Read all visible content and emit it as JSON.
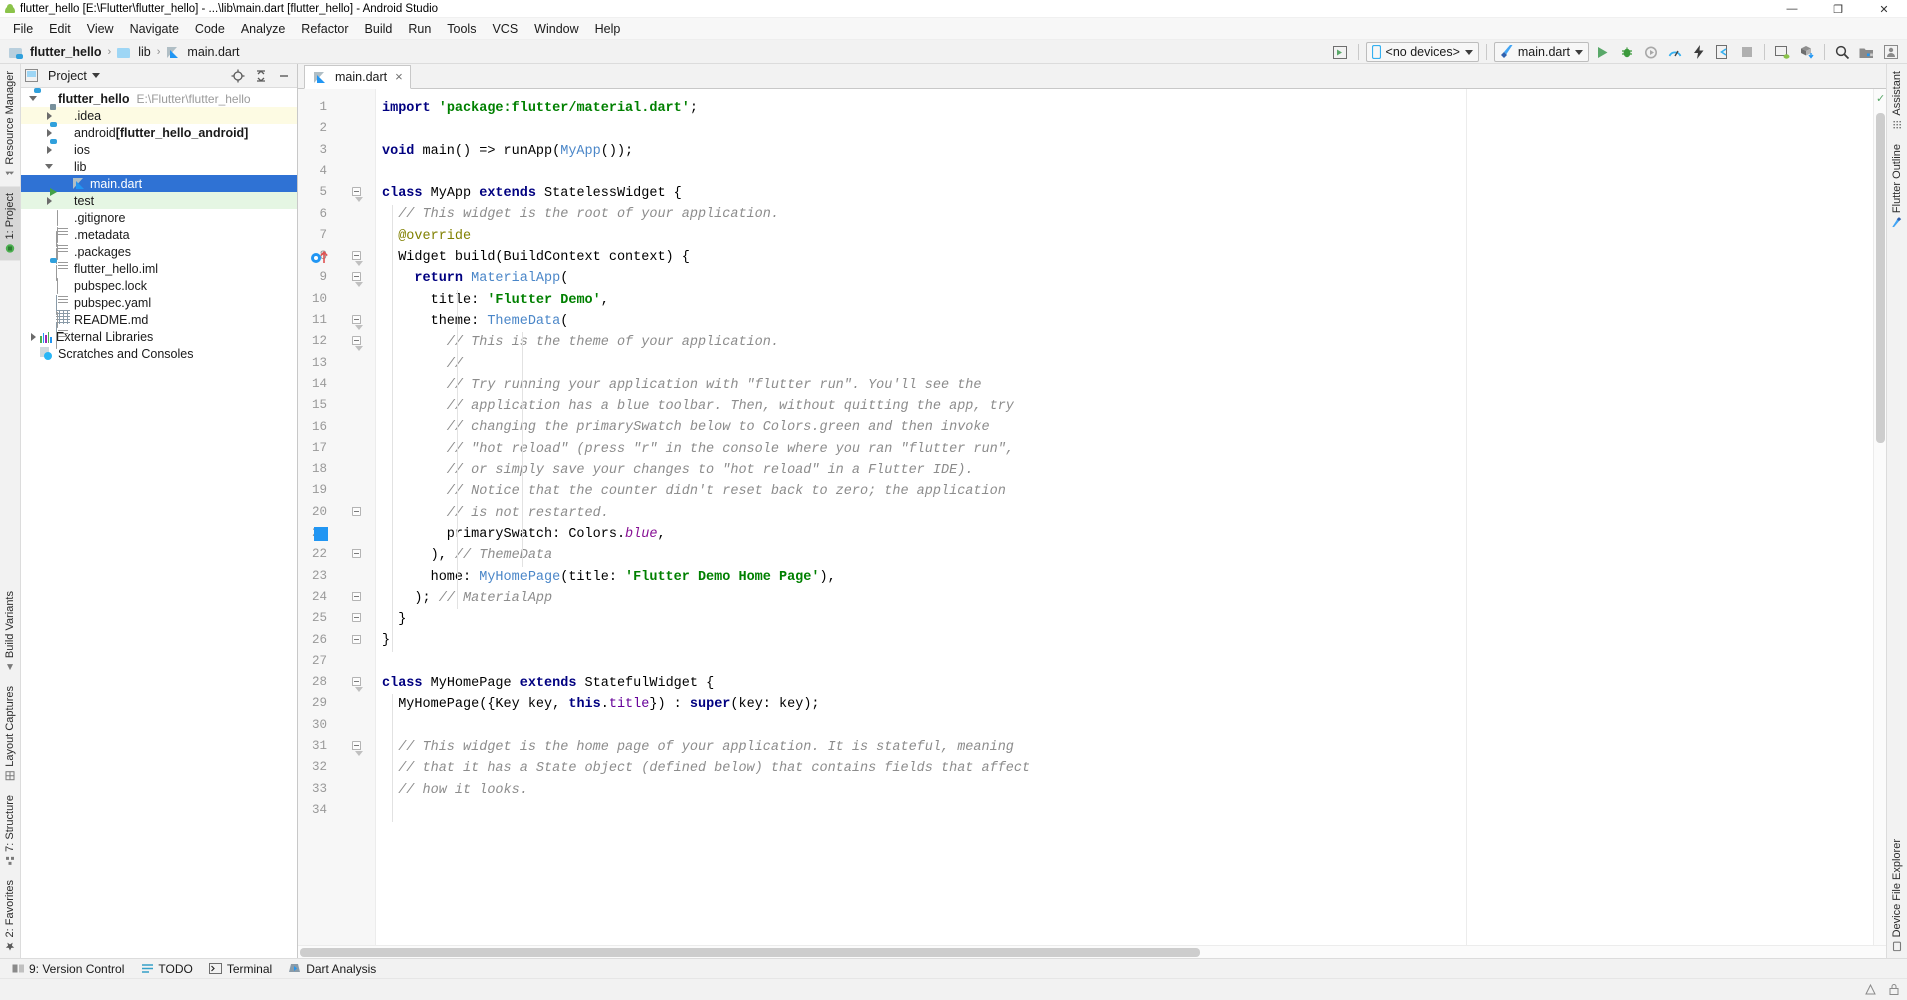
{
  "window": {
    "title": "flutter_hello [E:\\Flutter\\flutter_hello] - ...\\lib\\main.dart [flutter_hello] - Android Studio",
    "minimize": "—",
    "maximize": "❐",
    "close": "✕"
  },
  "menubar": {
    "items": [
      "File",
      "Edit",
      "View",
      "Navigate",
      "Code",
      "Analyze",
      "Refactor",
      "Build",
      "Run",
      "Tools",
      "VCS",
      "Window",
      "Help"
    ]
  },
  "navbar": {
    "breadcrumbs": [
      "flutter_hello",
      "lib",
      "main.dart"
    ],
    "separator": "›",
    "device_selector": "<no devices>",
    "run_config": "main.dart"
  },
  "project_panel": {
    "title": "Project",
    "tree": [
      {
        "label": "flutter_hello",
        "path": "E:\\Flutter\\flutter_hello",
        "indent": 0,
        "arrow": "open",
        "icon": "module-icon",
        "bold": true,
        "state": ""
      },
      {
        "label": ".idea",
        "path": "",
        "indent": 1,
        "arrow": "closed",
        "icon": "idea-folder-icon",
        "bold": false,
        "state": "yellow"
      },
      {
        "label": "android ",
        "suffix": "[flutter_hello_android]",
        "path": "",
        "indent": 1,
        "arrow": "closed",
        "icon": "module-icon",
        "bold": false,
        "state": ""
      },
      {
        "label": "ios",
        "path": "",
        "indent": 1,
        "arrow": "closed",
        "icon": "module-icon",
        "bold": false,
        "state": ""
      },
      {
        "label": "lib",
        "path": "",
        "indent": 1,
        "arrow": "open",
        "icon": "folder-icon",
        "bold": false,
        "state": ""
      },
      {
        "label": "main.dart",
        "path": "",
        "indent": 2,
        "arrow": "none",
        "icon": "dart-file-icon",
        "bold": false,
        "state": "selected"
      },
      {
        "label": "test",
        "path": "",
        "indent": 1,
        "arrow": "closed",
        "icon": "test-folder-icon",
        "bold": false,
        "state": "green"
      },
      {
        "label": ".gitignore",
        "path": "",
        "indent": 1,
        "arrow": "none",
        "icon": "file-icon",
        "bold": false,
        "state": ""
      },
      {
        "label": ".metadata",
        "path": "",
        "indent": 1,
        "arrow": "none",
        "icon": "file-icon",
        "bold": false,
        "state": ""
      },
      {
        "label": ".packages",
        "path": "",
        "indent": 1,
        "arrow": "none",
        "icon": "file-icon",
        "bold": false,
        "state": ""
      },
      {
        "label": "flutter_hello.iml",
        "path": "",
        "indent": 1,
        "arrow": "none",
        "icon": "module-icon",
        "bold": false,
        "state": ""
      },
      {
        "label": "pubspec.lock",
        "path": "",
        "indent": 1,
        "arrow": "none",
        "icon": "file-icon",
        "bold": false,
        "state": ""
      },
      {
        "label": "pubspec.yaml",
        "path": "",
        "indent": 1,
        "arrow": "none",
        "icon": "yaml-file-icon",
        "bold": false,
        "state": ""
      },
      {
        "label": "README.md",
        "path": "",
        "indent": 1,
        "arrow": "none",
        "icon": "file-icon",
        "bold": false,
        "state": ""
      },
      {
        "label": "External Libraries",
        "path": "",
        "indent": 0,
        "arrow": "closed",
        "icon": "libraries-icon",
        "bold": false,
        "state": ""
      },
      {
        "label": "Scratches and Consoles",
        "path": "",
        "indent": 0,
        "arrow": "none",
        "icon": "scratches-icon",
        "bold": false,
        "state": ""
      }
    ]
  },
  "left_strip": {
    "top": [
      {
        "label": "Resource Manager",
        "icon": "resource-manager-icon",
        "selected": false
      },
      {
        "label": "1: Project",
        "icon": "project-icon",
        "selected": true
      }
    ],
    "bottom": [
      {
        "label": "Build Variants",
        "icon": "build-variants-icon",
        "selected": false
      },
      {
        "label": "Layout Captures",
        "icon": "layout-captures-icon",
        "selected": false
      },
      {
        "label": "7: Structure",
        "icon": "structure-icon",
        "selected": false
      },
      {
        "label": "2: Favorites",
        "icon": "favorites-icon",
        "selected": false
      }
    ]
  },
  "right_strip": {
    "top": [
      {
        "label": "Assistant",
        "icon": "assistant-icon",
        "selected": false
      },
      {
        "label": "Flutter Outline",
        "icon": "flutter-icon",
        "selected": false
      }
    ],
    "bottom": [
      {
        "label": "Device File Explorer",
        "icon": "device-file-explorer-icon",
        "selected": false
      }
    ]
  },
  "editor": {
    "tab": {
      "label": "main.dart",
      "close": "×"
    },
    "first_line": 1,
    "lines": [
      {
        "n": 1,
        "segs": [
          {
            "t": "import ",
            "c": "kw-b"
          },
          {
            "t": "'package:flutter/material.dart'",
            "c": "str"
          },
          {
            "t": ";",
            "c": ""
          }
        ]
      },
      {
        "n": 2,
        "segs": []
      },
      {
        "n": 3,
        "segs": [
          {
            "t": "void",
            "c": "kw"
          },
          {
            "t": " main() => runApp(",
            "c": ""
          },
          {
            "t": "MyApp",
            "c": "type"
          },
          {
            "t": "());",
            "c": ""
          }
        ]
      },
      {
        "n": 4,
        "segs": []
      },
      {
        "n": 5,
        "segs": [
          {
            "t": "class",
            "c": "kw"
          },
          {
            "t": " MyApp ",
            "c": ""
          },
          {
            "t": "extends",
            "c": "kw"
          },
          {
            "t": " StatelessWidget {",
            "c": ""
          }
        ]
      },
      {
        "n": 6,
        "segs": [
          {
            "t": "  // This widget is the root of your application.",
            "c": "cmt"
          }
        ]
      },
      {
        "n": 7,
        "segs": [
          {
            "t": "  ",
            "c": ""
          },
          {
            "t": "@override",
            "c": "anno"
          }
        ]
      },
      {
        "n": 8,
        "segs": [
          {
            "t": "  Widget build(BuildContext context) {",
            "c": ""
          }
        ]
      },
      {
        "n": 9,
        "segs": [
          {
            "t": "    ",
            "c": ""
          },
          {
            "t": "return",
            "c": "kw"
          },
          {
            "t": " ",
            "c": ""
          },
          {
            "t": "MaterialApp",
            "c": "type"
          },
          {
            "t": "(",
            "c": ""
          }
        ]
      },
      {
        "n": 10,
        "segs": [
          {
            "t": "      title: ",
            "c": ""
          },
          {
            "t": "'Flutter Demo'",
            "c": "str"
          },
          {
            "t": ",",
            "c": ""
          }
        ]
      },
      {
        "n": 11,
        "segs": [
          {
            "t": "      theme: ",
            "c": ""
          },
          {
            "t": "ThemeData",
            "c": "type"
          },
          {
            "t": "(",
            "c": ""
          }
        ]
      },
      {
        "n": 12,
        "segs": [
          {
            "t": "        // This is the theme of your application.",
            "c": "cmt"
          }
        ]
      },
      {
        "n": 13,
        "segs": [
          {
            "t": "        //",
            "c": "cmt"
          }
        ]
      },
      {
        "n": 14,
        "segs": [
          {
            "t": "        // Try running your application with \"flutter run\". You'll see the",
            "c": "cmt"
          }
        ]
      },
      {
        "n": 15,
        "segs": [
          {
            "t": "        // application has a blue toolbar. Then, without quitting the app, try",
            "c": "cmt"
          }
        ]
      },
      {
        "n": 16,
        "segs": [
          {
            "t": "        // changing the primarySwatch below to Colors.green and then invoke",
            "c": "cmt"
          }
        ]
      },
      {
        "n": 17,
        "segs": [
          {
            "t": "        // \"hot reload\" (press \"r\" in the console where you ran \"flutter run\",",
            "c": "cmt"
          }
        ]
      },
      {
        "n": 18,
        "segs": [
          {
            "t": "        // or simply save your changes to \"hot reload\" in a Flutter IDE).",
            "c": "cmt"
          }
        ]
      },
      {
        "n": 19,
        "segs": [
          {
            "t": "        // Notice that the counter didn't reset back to zero; the application",
            "c": "cmt"
          }
        ]
      },
      {
        "n": 20,
        "segs": [
          {
            "t": "        // is not restarted.",
            "c": "cmt"
          }
        ]
      },
      {
        "n": 21,
        "segs": [
          {
            "t": "        primarySwatch: Colors.",
            "c": ""
          },
          {
            "t": "blue",
            "c": "cnst"
          },
          {
            "t": ",",
            "c": ""
          }
        ]
      },
      {
        "n": 22,
        "segs": [
          {
            "t": "      ), ",
            "c": ""
          },
          {
            "t": "// ThemeData",
            "c": "cmt"
          }
        ]
      },
      {
        "n": 23,
        "segs": [
          {
            "t": "      home: ",
            "c": ""
          },
          {
            "t": "MyHomePage",
            "c": "type"
          },
          {
            "t": "(title: ",
            "c": ""
          },
          {
            "t": "'Flutter Demo Home Page'",
            "c": "str"
          },
          {
            "t": "),",
            "c": ""
          }
        ]
      },
      {
        "n": 24,
        "segs": [
          {
            "t": "    ); ",
            "c": ""
          },
          {
            "t": "// MaterialApp",
            "c": "cmt"
          }
        ]
      },
      {
        "n": 25,
        "segs": [
          {
            "t": "  }",
            "c": ""
          }
        ]
      },
      {
        "n": 26,
        "segs": [
          {
            "t": "}",
            "c": ""
          }
        ]
      },
      {
        "n": 27,
        "segs": []
      },
      {
        "n": 28,
        "segs": [
          {
            "t": "class",
            "c": "kw"
          },
          {
            "t": " MyHomePage ",
            "c": ""
          },
          {
            "t": "extends",
            "c": "kw"
          },
          {
            "t": " StatefulWidget {",
            "c": ""
          }
        ]
      },
      {
        "n": 29,
        "segs": [
          {
            "t": "  MyHomePage({Key key, ",
            "c": ""
          },
          {
            "t": "this",
            "c": "kw"
          },
          {
            "t": ".",
            "c": ""
          },
          {
            "t": "title",
            "c": "fld"
          },
          {
            "t": "}) : ",
            "c": ""
          },
          {
            "t": "super",
            "c": "kw"
          },
          {
            "t": "(key: key);",
            "c": ""
          }
        ]
      },
      {
        "n": 30,
        "segs": []
      },
      {
        "n": 31,
        "segs": [
          {
            "t": "  // This widget is the home page of your application. It is stateful, meaning",
            "c": "cmt"
          }
        ]
      },
      {
        "n": 32,
        "segs": [
          {
            "t": "  // that it has a State object (defined below) that contains fields that affect",
            "c": "cmt"
          }
        ]
      },
      {
        "n": 33,
        "segs": [
          {
            "t": "  // how it looks.",
            "c": "cmt"
          }
        ]
      },
      {
        "n": 34,
        "segs": []
      }
    ],
    "gutter_marks": [
      {
        "line": 8,
        "type": "override-marker-icon"
      },
      {
        "line": 21,
        "type": "color-swatch",
        "color": "#2196f3"
      }
    ],
    "fold_marks": [
      {
        "line": 5,
        "kind": "start"
      },
      {
        "line": 8,
        "kind": "start"
      },
      {
        "line": 9,
        "kind": "start"
      },
      {
        "line": 11,
        "kind": "start"
      },
      {
        "line": 12,
        "kind": "start"
      },
      {
        "line": 20,
        "kind": "end"
      },
      {
        "line": 22,
        "kind": "end"
      },
      {
        "line": 24,
        "kind": "end"
      },
      {
        "line": 25,
        "kind": "end"
      },
      {
        "line": 26,
        "kind": "end"
      },
      {
        "line": 28,
        "kind": "start"
      },
      {
        "line": 31,
        "kind": "start"
      }
    ],
    "inspection_status": "✓"
  },
  "bottom_tool_window_bar": {
    "items": [
      {
        "label": "9: Version Control",
        "icon": "version-control-icon"
      },
      {
        "label": "TODO",
        "icon": "todo-icon"
      },
      {
        "label": "Terminal",
        "icon": "terminal-icon"
      },
      {
        "label": "Dart Analysis",
        "icon": "dart-analysis-icon"
      }
    ]
  },
  "statusbar": {
    "right_text": "⚒",
    "lock": "🔒"
  },
  "colors": {
    "selection_blue": "#2f72d4",
    "accent_green": "#59a869",
    "keyword": "#000080",
    "string": "#008000",
    "comment": "#8c8c8c",
    "type": "#4a86c8"
  }
}
